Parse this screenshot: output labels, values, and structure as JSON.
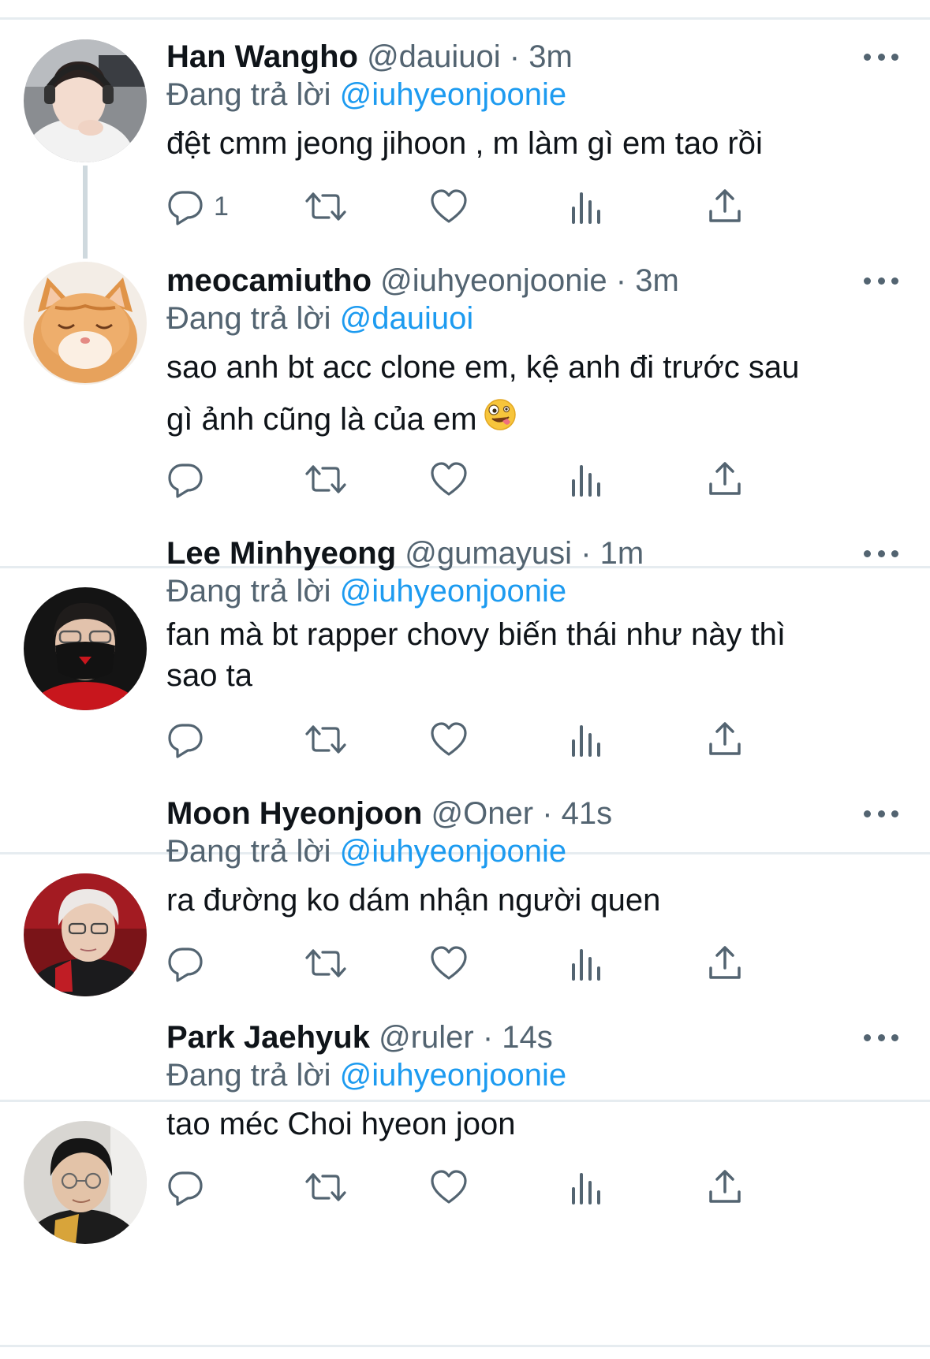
{
  "replying_prefix": "Đang trả lời",
  "tweets": [
    {
      "name": "Han Wangho",
      "handle": "@dauiuoi",
      "time": "3m",
      "reply_to": "@iuhyeonjoonie",
      "text": "đệt cmm jeong jihoon , m làm gì em tao rồi",
      "reply_count": "1"
    },
    {
      "name": "meocamiutho",
      "handle": "@iuhyeonjoonie",
      "time": "3m",
      "reply_to": "@dauiuoi",
      "text_line1": "sao anh bt acc clone em, kệ anh đi trước sau",
      "text_line2": "gì ảnh cũng là của em",
      "emoji": "zany-face-emoji"
    },
    {
      "name": "Lee Minhyeong",
      "handle": "@gumayusi",
      "time": "1m",
      "reply_to": "@iuhyeonjoonie",
      "text_line1": "fan mà bt rapper chovy biến thái như này thì",
      "text_line2": "sao ta"
    },
    {
      "name": "Moon Hyeonjoon",
      "handle": "@Oner",
      "time": "41s",
      "reply_to": "@iuhyeonjoonie",
      "text": "ra đường ko dám nhận người quen"
    },
    {
      "name": "Park Jaehyuk",
      "handle": "@ruler",
      "time": "14s",
      "reply_to": "@iuhyeonjoonie",
      "text": "tao méc Choi hyeon joon"
    }
  ],
  "icons": [
    "reply-icon",
    "retweet-icon",
    "like-icon",
    "views-icon",
    "share-icon",
    "more-icon"
  ],
  "colors": {
    "text": "#0f1419",
    "muted": "#536471",
    "link": "#1d9bf0",
    "divider": "#e6ecf0"
  }
}
